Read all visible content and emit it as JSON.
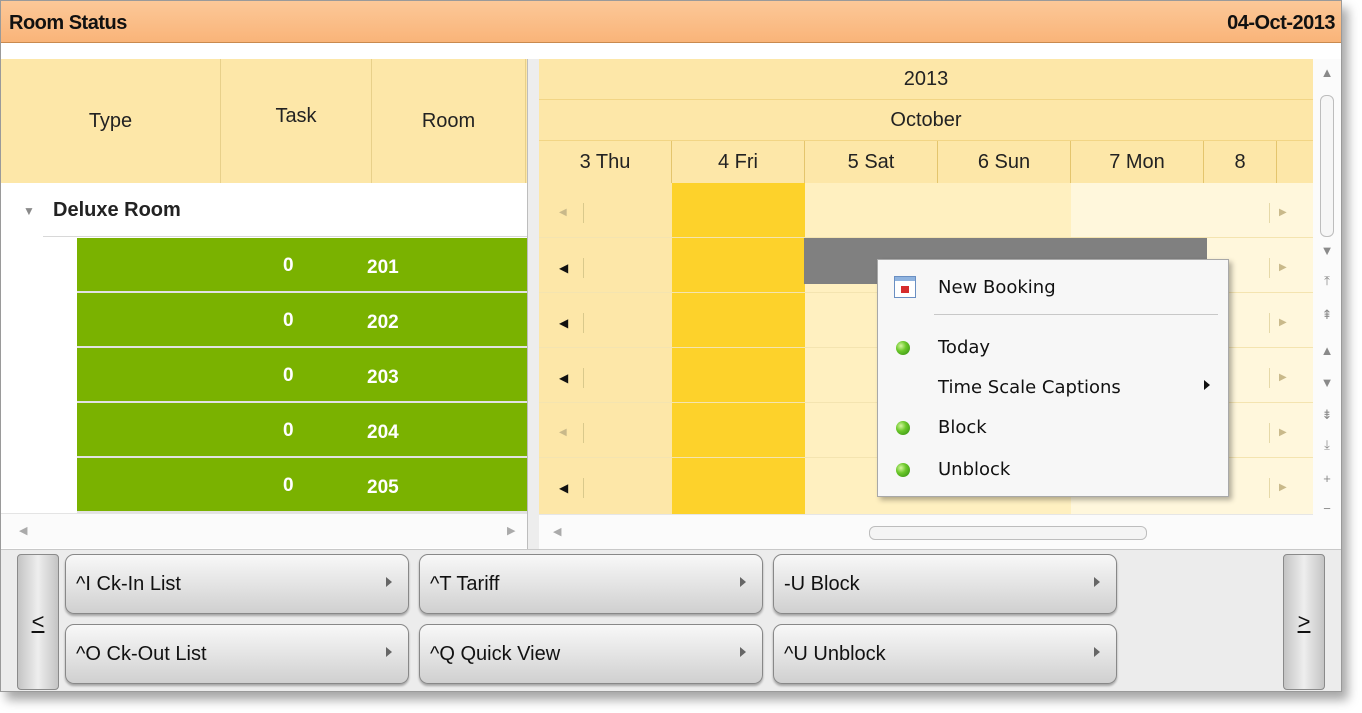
{
  "window": {
    "title": "Room Status",
    "date": "04-Oct-2013"
  },
  "left_header": {
    "columns": [
      "Type",
      "Task",
      "Room"
    ]
  },
  "group": {
    "label": "Deluxe Room",
    "expand_icon": "triangle-down-icon"
  },
  "rooms": [
    {
      "task": "0",
      "room": "201"
    },
    {
      "task": "0",
      "room": "202"
    },
    {
      "task": "0",
      "room": "203"
    },
    {
      "task": "0",
      "room": "204"
    },
    {
      "task": "0",
      "room": "205"
    }
  ],
  "schedule": {
    "year": "2013",
    "month": "October",
    "days": [
      "3 Thu",
      "4 Fri",
      "5 Sat",
      "6 Sun",
      "7 Mon",
      "8"
    ],
    "today_color": "#fdd22b",
    "booking_color": "#808080"
  },
  "context_menu": {
    "items": [
      {
        "label": "New Booking",
        "icon": "calendar-icon"
      },
      {
        "label": "Today",
        "icon": "green-dot-icon"
      },
      {
        "label": "Time Scale Captions",
        "icon": "",
        "submenu": true
      },
      {
        "label": "Block",
        "icon": "green-dot-icon"
      },
      {
        "label": "Unblock",
        "icon": "green-dot-icon"
      }
    ]
  },
  "scrollbar_buttons": [
    "▲",
    "▼",
    "⤒",
    "⇞",
    "▲",
    "▼",
    "⇟",
    "⤓",
    "+",
    "−"
  ],
  "toolbar": {
    "prev": "<",
    "next": ">",
    "buttons": [
      {
        "label": "^I Ck-In List"
      },
      {
        "label": "^T Tariff"
      },
      {
        "label": "-U Block"
      },
      {
        "label": "^O Ck-Out List"
      },
      {
        "label": "^Q Quick View"
      },
      {
        "label": "^U Unblock"
      }
    ]
  }
}
